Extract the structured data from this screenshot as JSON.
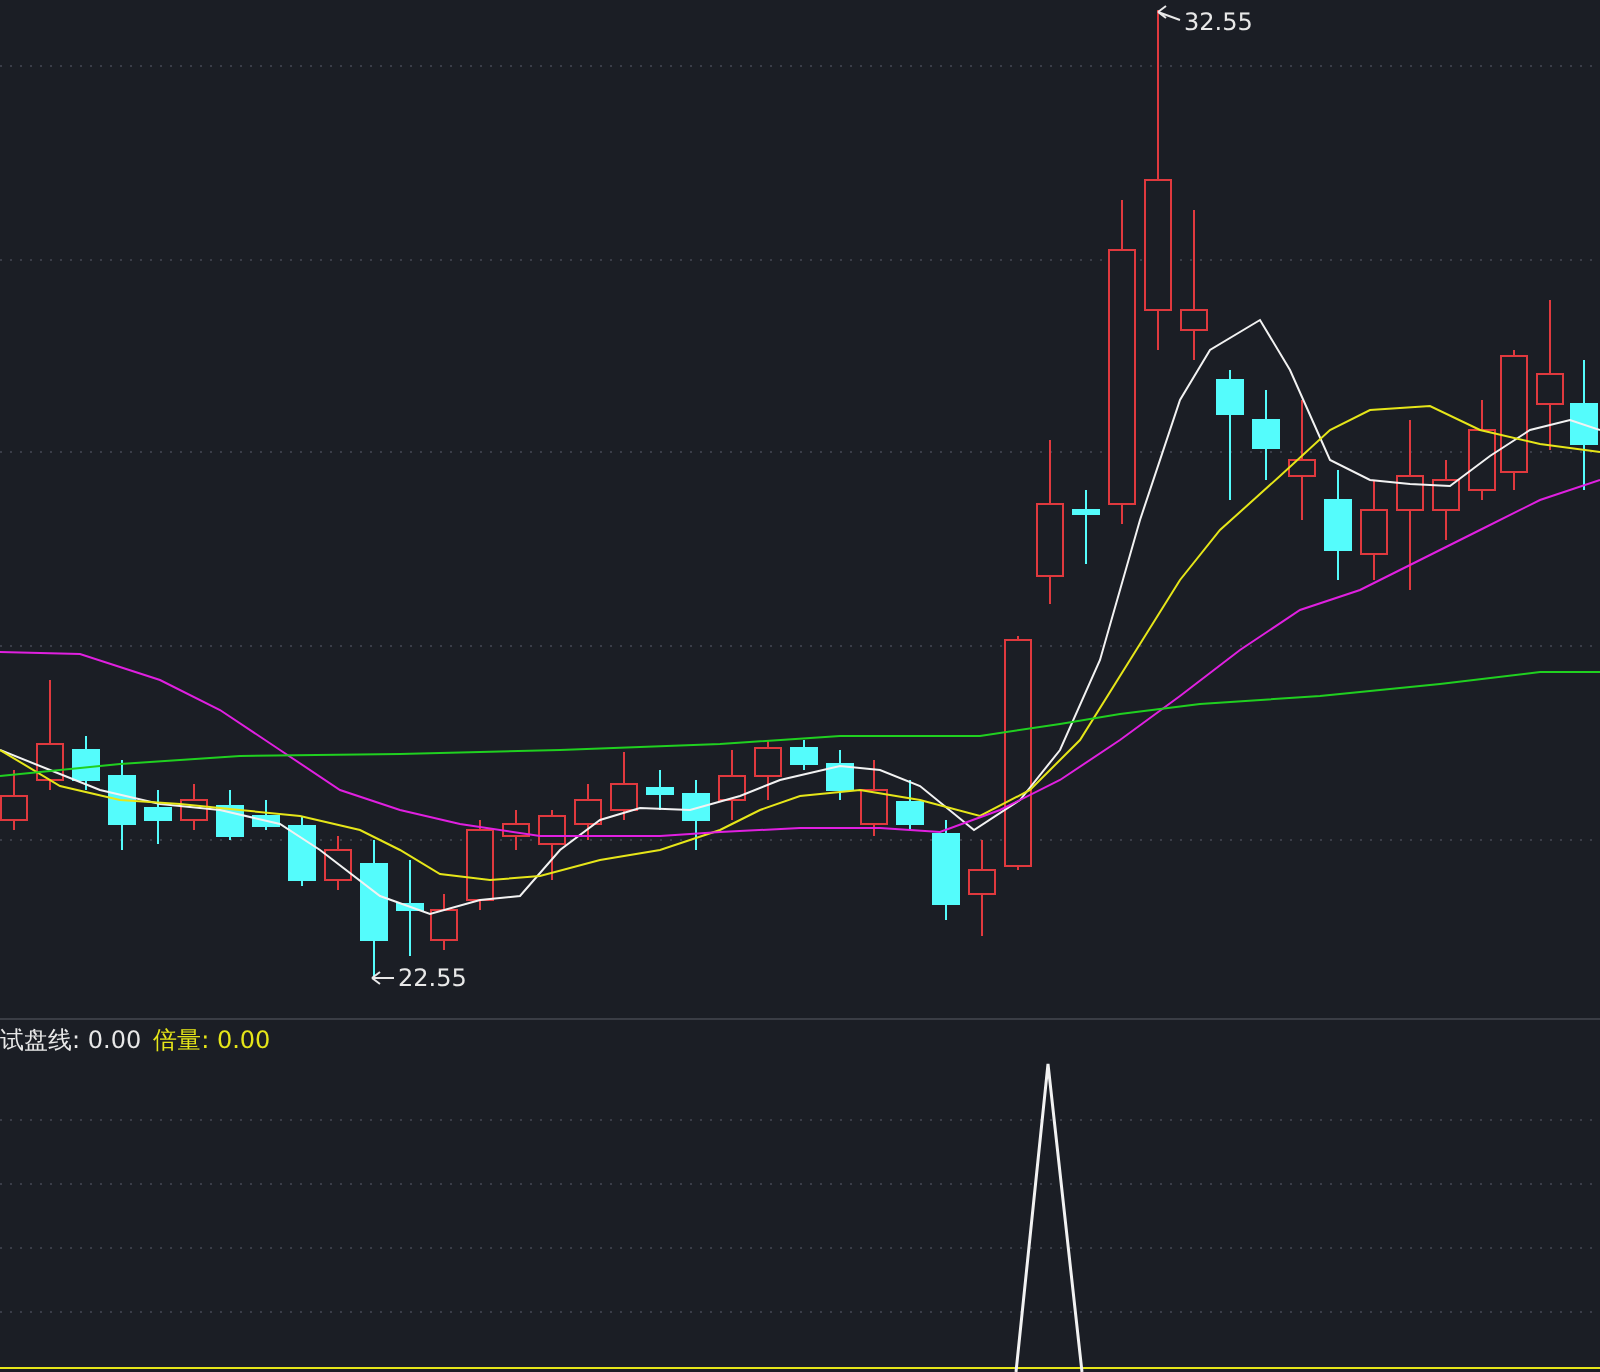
{
  "price_chart": {
    "high_label": "32.55",
    "low_label": "22.55"
  },
  "indicator_pane": {
    "legend": [
      {
        "label": "试盘线:",
        "value": "0.00",
        "color": "#e8e8e8"
      },
      {
        "label": "倍量:",
        "value": "0.00",
        "color": "#e6e619"
      }
    ]
  }
}
